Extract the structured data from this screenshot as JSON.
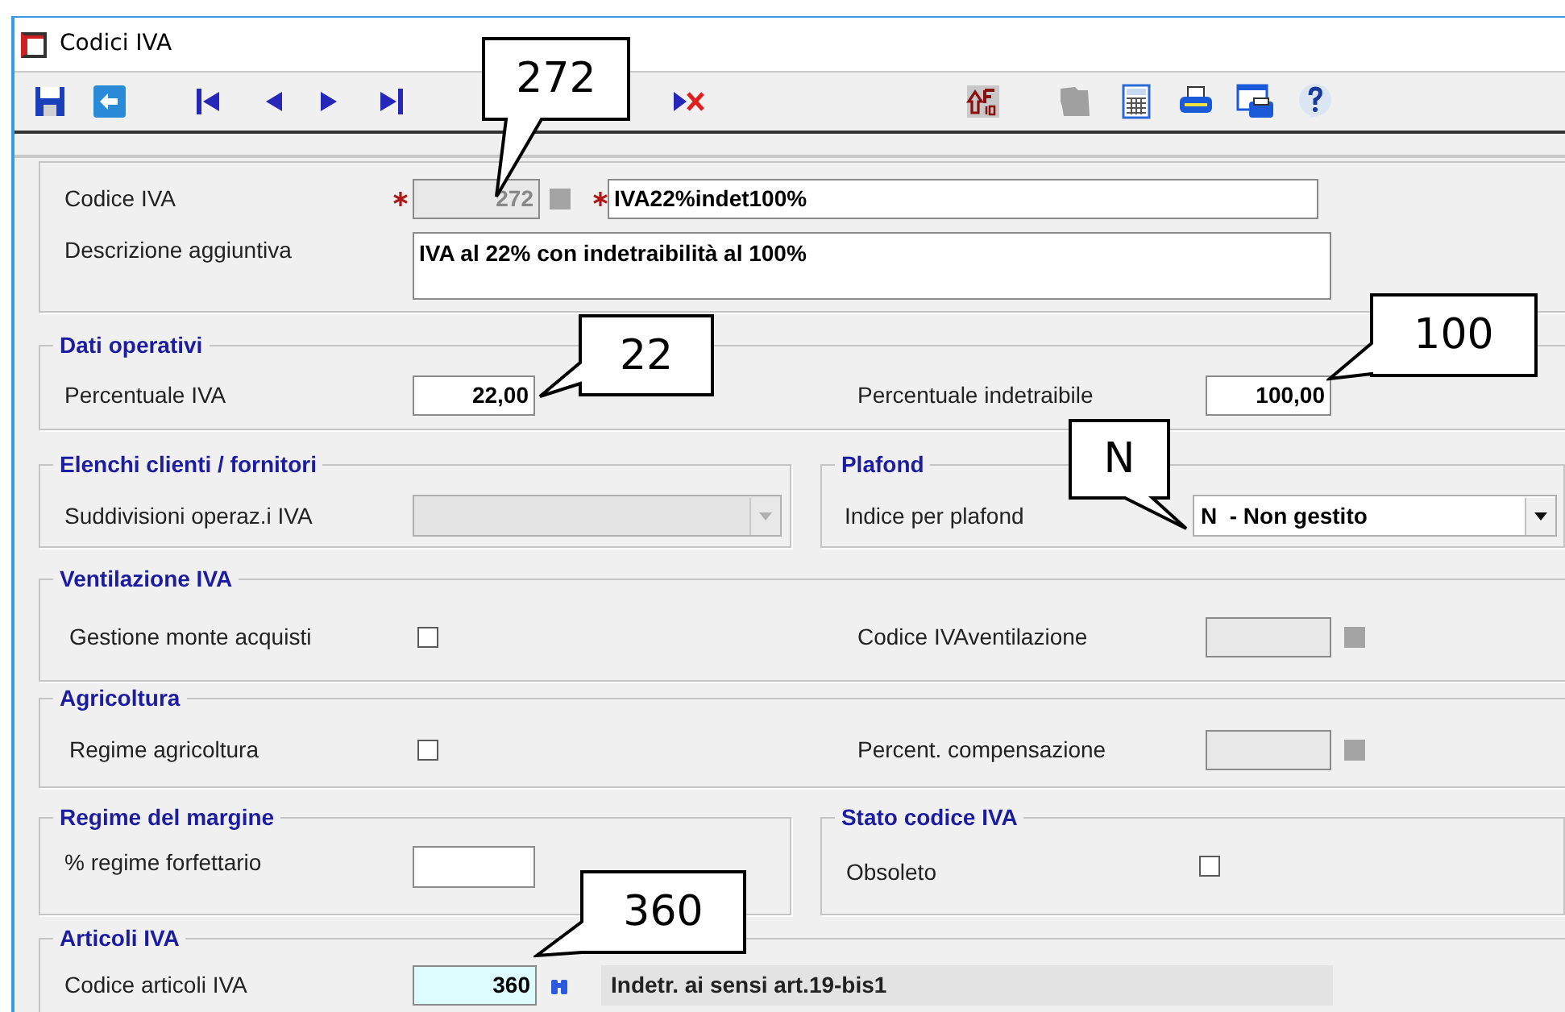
{
  "window": {
    "title": "Codici IVA"
  },
  "toolbar": [
    {
      "kind": "save",
      "disabled": false
    },
    {
      "kind": "back",
      "disabled": false
    },
    {
      "kind": "first",
      "disabled": false
    },
    {
      "kind": "prev",
      "disabled": false
    },
    {
      "kind": "next",
      "disabled": false
    },
    {
      "kind": "last",
      "disabled": false
    },
    {
      "kind": "delete",
      "disabled": false
    },
    {
      "kind": "shift-f10",
      "disabled": false
    },
    {
      "kind": "map",
      "disabled": true
    },
    {
      "kind": "calculator",
      "disabled": false
    },
    {
      "kind": "print",
      "disabled": false
    },
    {
      "kind": "print-preview",
      "disabled": false
    },
    {
      "kind": "help",
      "disabled": false
    }
  ],
  "codice_iva": {
    "label": "Codice IVA",
    "value": "272",
    "required": true,
    "disabled": true
  },
  "descrizione": {
    "value": "IVA22%indet100%",
    "required": true
  },
  "descrizione_aggiuntiva": {
    "label": "Descrizione aggiuntiva",
    "value": "IVA al 22% con indetraibilità al 100%"
  },
  "dati_operativi": {
    "title": "Dati operativi",
    "percentuale_iva": {
      "label": "Percentuale IVA",
      "value": "22,00"
    },
    "percentuale_indetraibile": {
      "label": "Percentuale indetraibile",
      "value": "100,00"
    }
  },
  "elenchi": {
    "title": "Elenchi clienti / fornitori",
    "suddivisioni": {
      "label": "Suddivisioni operaz.i IVA",
      "disabled": true
    }
  },
  "plafond": {
    "title": "Plafond",
    "indice": {
      "label": "Indice per plafond",
      "value": "N  - Non gestito",
      "disabled": false
    }
  },
  "ventilazione": {
    "title": "Ventilazione IVA",
    "gestione": {
      "label": "Gestione monte acquisti",
      "checked": false
    },
    "codice": {
      "label": "Codice IVAventilazione",
      "disabled": true
    }
  },
  "agricoltura": {
    "title": "Agricoltura",
    "regime": {
      "label": "Regime agricoltura",
      "checked": false
    },
    "compensazione": {
      "label": "Percent. compensazione",
      "disabled": true
    }
  },
  "regime_margine": {
    "title": "Regime del margine",
    "forfettario": {
      "label": "% regime forfettario"
    }
  },
  "stato": {
    "title": "Stato codice IVA",
    "obsoleto": {
      "label": "Obsoleto",
      "checked": false
    }
  },
  "articoli": {
    "title": "Articoli IVA",
    "codice": {
      "label": "Codice articoli IVA",
      "value": "360"
    },
    "descrizione": "Indetr. ai sensi art.19-bis1"
  },
  "callouts": [
    {
      "text": "272"
    },
    {
      "text": "22"
    },
    {
      "text": "100"
    },
    {
      "text": "N"
    },
    {
      "text": "360"
    }
  ]
}
